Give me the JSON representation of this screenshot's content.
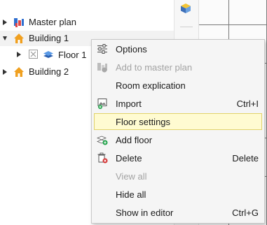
{
  "tree": {
    "items": [
      {
        "label": "Master plan",
        "icon": "master-plan-icon"
      },
      {
        "label": "Building 1",
        "icon": "house-icon"
      },
      {
        "label": "Floor 1",
        "icon": "layers-icon"
      },
      {
        "label": "Building 2",
        "icon": "house-icon"
      }
    ]
  },
  "context_menu": {
    "items": [
      {
        "label": "Options",
        "shortcut": "",
        "icon": "sliders-icon",
        "disabled": false
      },
      {
        "label": "Add to master plan",
        "shortcut": "",
        "icon": "master-plan-icon",
        "disabled": true
      },
      {
        "label": "Room explication",
        "shortcut": "",
        "icon": "",
        "disabled": false
      },
      {
        "label": "Import",
        "shortcut": "Ctrl+I",
        "icon": "import-icon",
        "disabled": false
      },
      {
        "label": "Floor settings",
        "shortcut": "",
        "icon": "",
        "disabled": false,
        "highlighted": true
      },
      {
        "label": "Add floor",
        "shortcut": "",
        "icon": "add-floor-icon",
        "disabled": false
      },
      {
        "label": "Delete",
        "shortcut": "Delete",
        "icon": "delete-icon",
        "disabled": false
      },
      {
        "label": "View all",
        "shortcut": "",
        "icon": "",
        "disabled": true
      },
      {
        "label": "Hide all",
        "shortcut": "",
        "icon": "",
        "disabled": false
      },
      {
        "label": "Show in editor",
        "shortcut": "Ctrl+G",
        "icon": "",
        "disabled": false
      }
    ]
  },
  "colors": {
    "highlight_bg": "#fffbd1",
    "highlight_border": "#e2d36a",
    "disabled_text": "#a3a3a3",
    "house_orange": "#f0a020"
  }
}
